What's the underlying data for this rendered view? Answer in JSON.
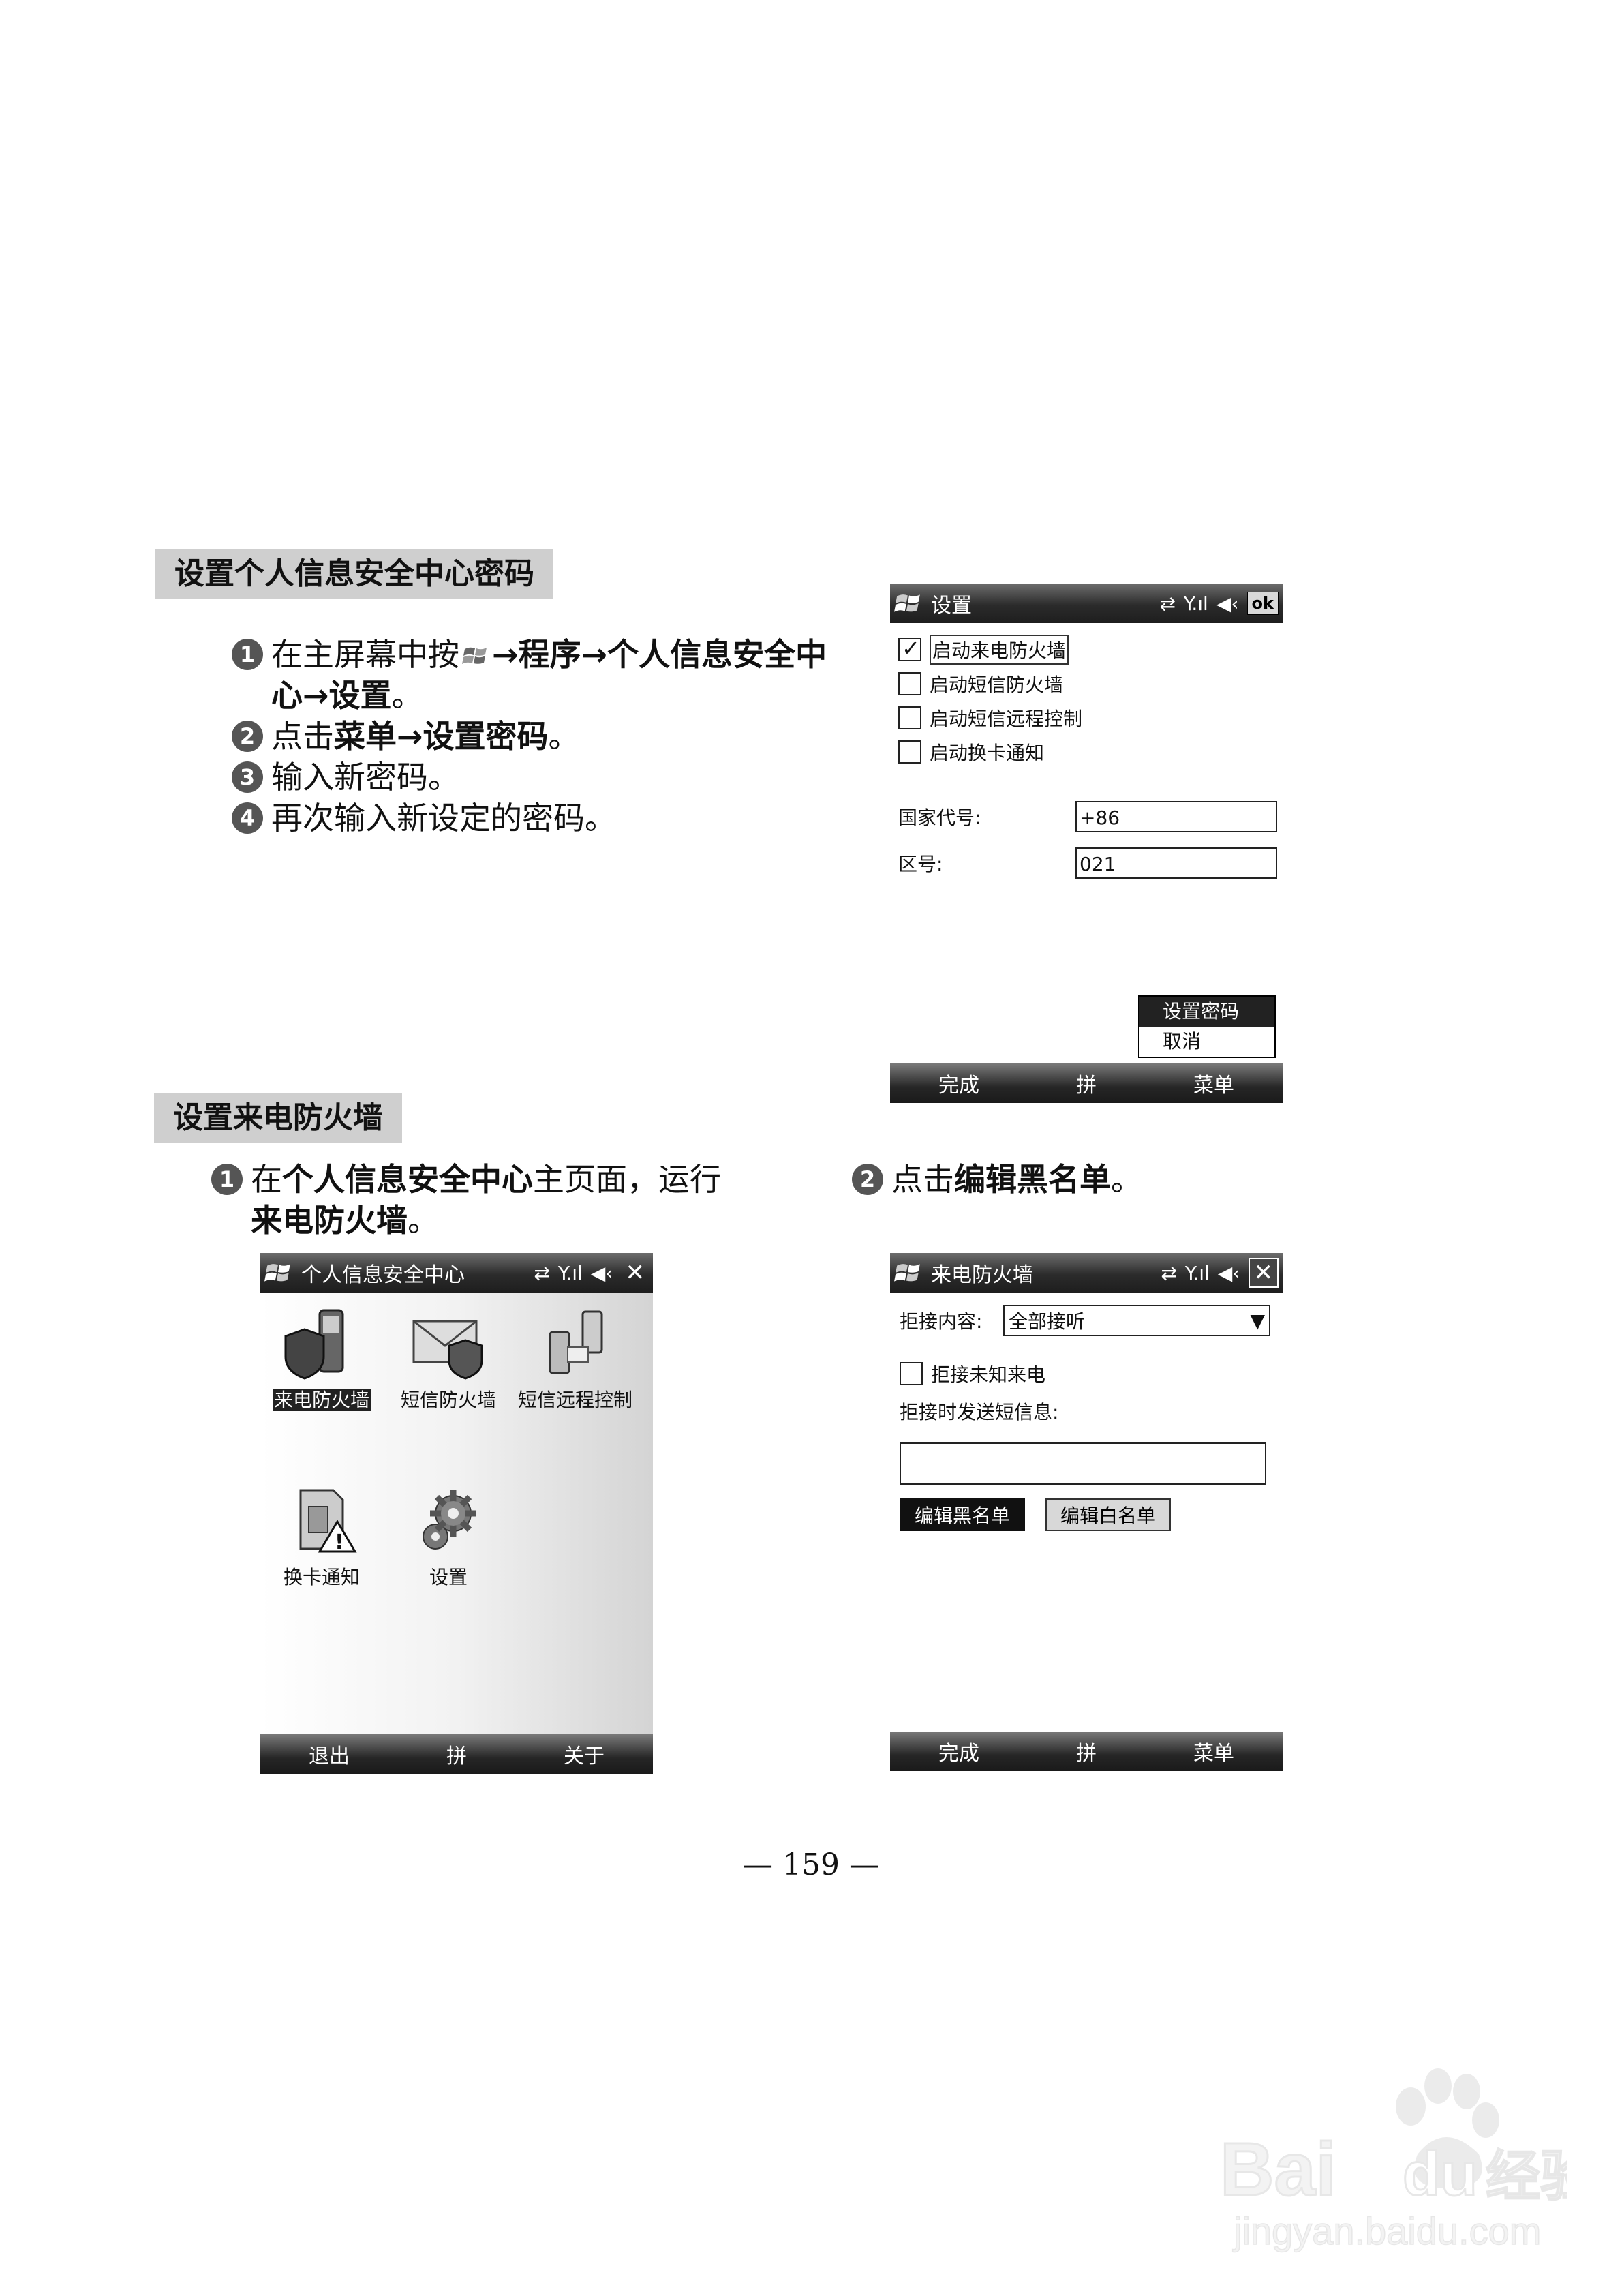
{
  "section1": {
    "heading": "设置个人信息安全中心密码",
    "steps": [
      {
        "num": "1",
        "parts": [
          "在主屏幕中按",
          "→",
          "程序",
          "→",
          "个人信息安全中心",
          "→",
          "设置",
          "。"
        ]
      },
      {
        "num": "2",
        "parts": [
          "点击",
          "菜单",
          "→",
          "设置密码",
          "。"
        ]
      },
      {
        "num": "3",
        "text": "输入新密码。"
      },
      {
        "num": "4",
        "text": "再次输入新设定的密码。"
      }
    ]
  },
  "screen_settings": {
    "title": "设置",
    "ok": "ok",
    "checkboxes": [
      {
        "label": "启动来电防火墙",
        "checked": true
      },
      {
        "label": "启动短信防火墙",
        "checked": false
      },
      {
        "label": "启动短信远程控制",
        "checked": false
      },
      {
        "label": "启动换卡通知",
        "checked": false
      }
    ],
    "country_label": "国家代号:",
    "country_value": "+86",
    "area_label": "区号:",
    "area_value": "021",
    "menu_items": [
      "设置密码",
      "取消"
    ],
    "softkeys": [
      "完成",
      "拼",
      "菜单"
    ]
  },
  "section2": {
    "heading": "设置来电防火墙",
    "step1": {
      "num": "1",
      "parts": [
        "在",
        "个人信息安全中心",
        "主页面，运行",
        "来电防火墙",
        "。"
      ]
    },
    "step2": {
      "num": "2",
      "parts": [
        "点击",
        "编辑黑名单",
        "。"
      ]
    }
  },
  "screen_home": {
    "title": "个人信息安全中心",
    "apps": [
      "来电防火墙",
      "短信防火墙",
      "短信远程控制",
      "换卡通知",
      "设置"
    ],
    "softkeys": [
      "退出",
      "拼",
      "关于"
    ]
  },
  "screen_firewall": {
    "title": "来电防火墙",
    "reject_label": "拒接内容:",
    "reject_value": "全部接听",
    "unknown_label": "拒接未知来电",
    "sms_label": "拒接时发送短信息:",
    "sms_value": "",
    "btn_black": "编辑黑名单",
    "btn_white": "编辑白名单",
    "softkeys": [
      "完成",
      "拼",
      "菜单"
    ]
  },
  "page_number": "— 159 —",
  "watermark": {
    "brand": "Bai",
    "brand2": "du",
    "cn": "经验",
    "url": "jingyan.baidu.com"
  }
}
